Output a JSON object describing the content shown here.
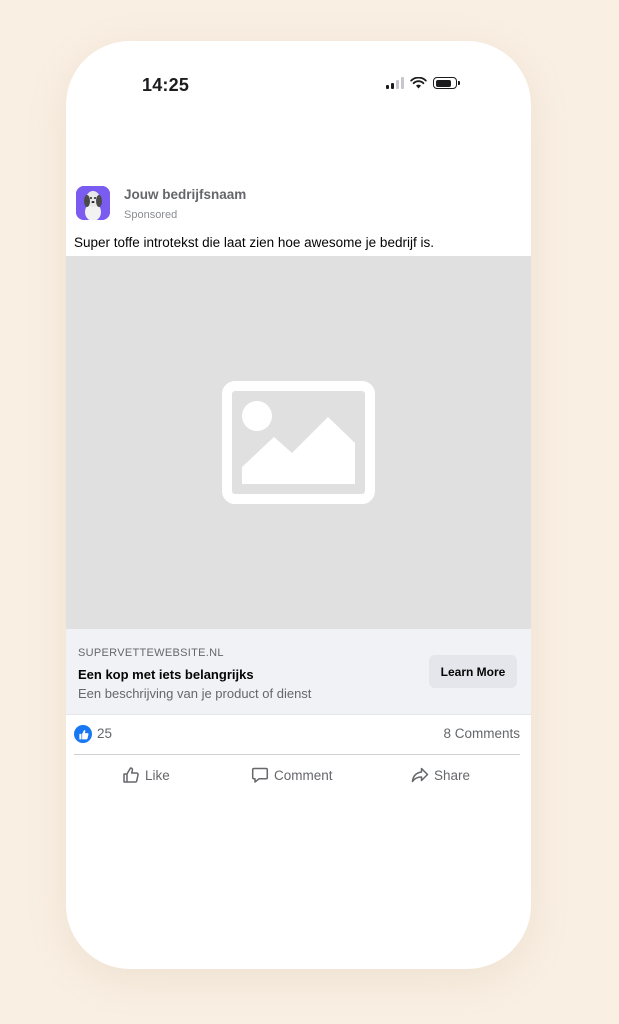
{
  "status_bar": {
    "time": "14:25"
  },
  "post": {
    "page_name": "Jouw bedrijfsnaam",
    "sponsored_label": "Sponsored",
    "intro_text": "Super toffe introtekst die laat zien hoe awesome je bedrijf is.",
    "link": {
      "domain": "SUPERVETTEWEBSITE.NL",
      "headline": "Een kop met iets belangrijks",
      "description": "Een beschrijving van je product of dienst",
      "cta_label": "Learn More"
    },
    "reactions": {
      "like_count": "25",
      "comments_label": "8 Comments"
    },
    "actions": {
      "like": "Like",
      "comment": "Comment",
      "share": "Share"
    }
  },
  "colors": {
    "background": "#f9efe3",
    "accent": "#1877f2",
    "avatar": "#7b5cf0",
    "media_placeholder": "#e0e0e0"
  }
}
